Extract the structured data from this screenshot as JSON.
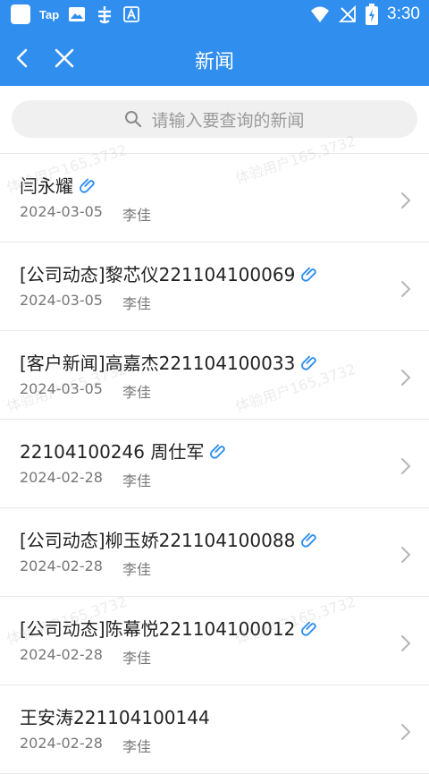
{
  "status_bar": {
    "app_labels": [
      "Tap"
    ],
    "time": "3:30"
  },
  "header": {
    "title": "新闻"
  },
  "search": {
    "placeholder": "请输入要查询的新闻"
  },
  "news": [
    {
      "title": "闫永耀",
      "date": "2024-03-05",
      "author": "李佳",
      "attachment": true
    },
    {
      "title": "[公司动态]黎芯仪221104100069",
      "date": "2024-03-05",
      "author": "李佳",
      "attachment": true
    },
    {
      "title": "[客户新闻]高嘉杰221104100033",
      "date": "2024-03-05",
      "author": "李佳",
      "attachment": true
    },
    {
      "title": "22104100246 周仕军",
      "date": "2024-02-28",
      "author": "李佳",
      "attachment": true
    },
    {
      "title": "[公司动态]柳玉娇221104100088",
      "date": "2024-02-28",
      "author": "李佳",
      "attachment": true
    },
    {
      "title": "[公司动态]陈幕悦221104100012",
      "date": "2024-02-28",
      "author": "李佳",
      "attachment": true
    },
    {
      "title": "王安涛221104100144",
      "date": "2024-02-28",
      "author": "李佳",
      "attachment": false
    }
  ],
  "watermark": "体验用户165,3732",
  "colors": {
    "accent": "#2f8eee",
    "attachment": "#2f8eee"
  }
}
